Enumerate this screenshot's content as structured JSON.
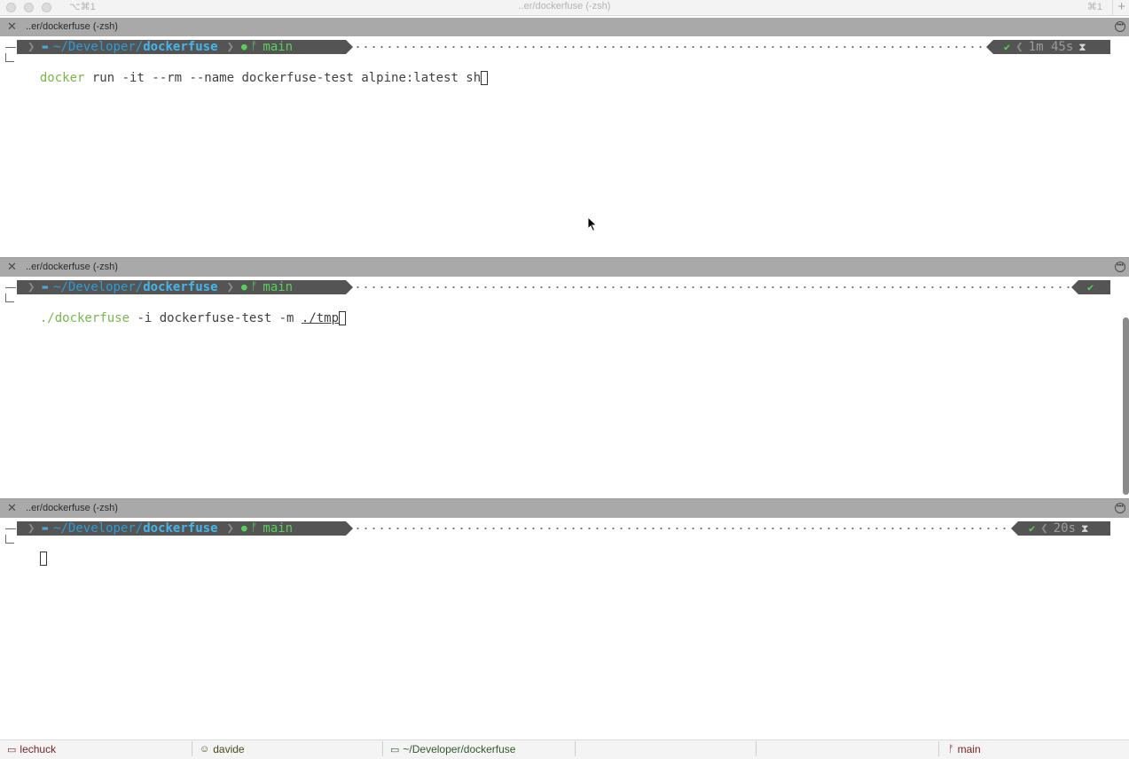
{
  "window": {
    "title": "..er/dockerfuse (-zsh)",
    "shortcut_left": "⌥⌘1",
    "shortcut_right": "⌘1",
    "new_tab_glyph": "+"
  },
  "panes": [
    {
      "header_title": "..er/dockerfuse (-zsh)",
      "prompt": {
        "path_prefix": "~/Developer/",
        "path_dir": "dockerfuse",
        "branch": "main",
        "status": "✔",
        "duration": "1m 45s"
      },
      "command": {
        "program": "docker",
        "args": " run -it --rm --name dockerfuse-test alpine:latest sh"
      }
    },
    {
      "header_title": "..er/dockerfuse (-zsh)",
      "prompt": {
        "path_prefix": "~/Developer/",
        "path_dir": "dockerfuse",
        "branch": "main",
        "status": "✔"
      },
      "command": {
        "program": "./dockerfuse",
        "args": " -i dockerfuse-test -m ",
        "path_arg": "./tmp"
      }
    },
    {
      "header_title": "..er/dockerfuse (-zsh)",
      "prompt": {
        "path_prefix": "~/Developer/",
        "path_dir": "dockerfuse",
        "branch": "main",
        "status": "✔",
        "duration": "20s"
      }
    }
  ],
  "statusbar": {
    "host": "lechuck",
    "user": "davide",
    "cwd": "~/Developer/dockerfuse",
    "branch": "main"
  },
  "colors": {
    "path": "#45b6ec",
    "branch": "#58d058",
    "header": "#a9a9a9",
    "segment": "#545454"
  }
}
